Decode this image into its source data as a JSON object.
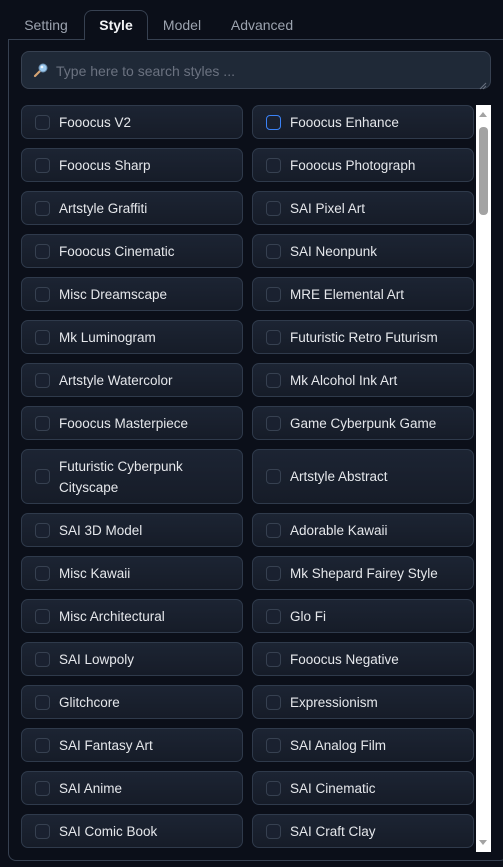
{
  "tabs": [
    {
      "label": "Setting",
      "active": false
    },
    {
      "label": "Style",
      "active": true
    },
    {
      "label": "Model",
      "active": false
    },
    {
      "label": "Advanced",
      "active": false
    }
  ],
  "search": {
    "placeholder": "Type here to search styles ...",
    "value": "",
    "icon": "magnifier-icon"
  },
  "styles": [
    {
      "label": "Fooocus V2",
      "checked": false
    },
    {
      "label": "Fooocus Enhance",
      "checked": false,
      "focused": true
    },
    {
      "label": "Fooocus Sharp",
      "checked": false
    },
    {
      "label": "Fooocus Photograph",
      "checked": false
    },
    {
      "label": "Artstyle Graffiti",
      "checked": false
    },
    {
      "label": "SAI Pixel Art",
      "checked": false
    },
    {
      "label": "Fooocus Cinematic",
      "checked": false
    },
    {
      "label": "SAI Neonpunk",
      "checked": false
    },
    {
      "label": "Misc Dreamscape",
      "checked": false
    },
    {
      "label": "MRE Elemental Art",
      "checked": false
    },
    {
      "label": "Mk Luminogram",
      "checked": false
    },
    {
      "label": "Futuristic Retro Futurism",
      "checked": false
    },
    {
      "label": "Artstyle Watercolor",
      "checked": false
    },
    {
      "label": "Mk Alcohol Ink Art",
      "checked": false
    },
    {
      "label": "Fooocus Masterpiece",
      "checked": false
    },
    {
      "label": "Game Cyberpunk Game",
      "checked": false
    },
    {
      "label": "Futuristic Cyberpunk Cityscape",
      "checked": false
    },
    {
      "label": "Artstyle Abstract",
      "checked": false
    },
    {
      "label": "SAI 3D Model",
      "checked": false
    },
    {
      "label": "Adorable Kawaii",
      "checked": false
    },
    {
      "label": "Misc Kawaii",
      "checked": false
    },
    {
      "label": "Mk Shepard Fairey Style",
      "checked": false
    },
    {
      "label": "Misc Architectural",
      "checked": false
    },
    {
      "label": "Glo Fi",
      "checked": false
    },
    {
      "label": "SAI Lowpoly",
      "checked": false
    },
    {
      "label": "Fooocus Negative",
      "checked": false
    },
    {
      "label": "Glitchcore",
      "checked": false
    },
    {
      "label": "Expressionism",
      "checked": false
    },
    {
      "label": "SAI Fantasy Art",
      "checked": false
    },
    {
      "label": "SAI Analog Film",
      "checked": false
    },
    {
      "label": "SAI Anime",
      "checked": false
    },
    {
      "label": "SAI Cinematic",
      "checked": false
    },
    {
      "label": "SAI Comic Book",
      "checked": false
    },
    {
      "label": "SAI Craft Clay",
      "checked": false
    }
  ],
  "colors": {
    "background": "#0b0f19",
    "card": "#1c2433",
    "border": "#374151",
    "focus": "#3b82f6"
  }
}
